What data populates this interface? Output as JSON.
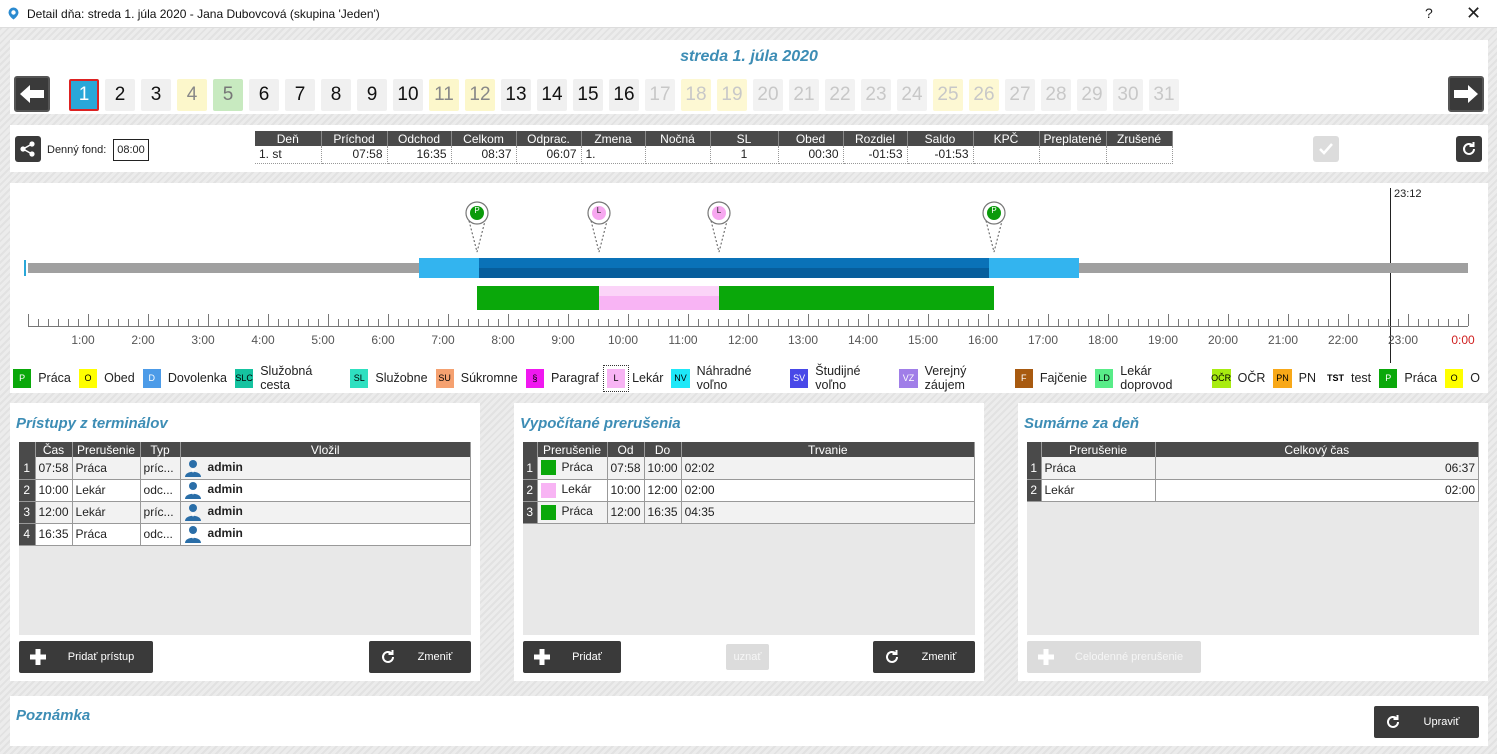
{
  "window": {
    "title": "Detail dňa: streda 1. júla 2020 -  Jana Dubovcová  (skupina 'Jeden')",
    "help": "?",
    "close": "✕"
  },
  "header": {
    "date_title": "streda 1. júla 2020"
  },
  "days": [
    {
      "n": "1",
      "state": "sel"
    },
    {
      "n": "2",
      "state": "norm"
    },
    {
      "n": "3",
      "state": "norm"
    },
    {
      "n": "4",
      "state": "yel"
    },
    {
      "n": "5",
      "state": "grn"
    },
    {
      "n": "6",
      "state": "norm"
    },
    {
      "n": "7",
      "state": "norm"
    },
    {
      "n": "8",
      "state": "norm"
    },
    {
      "n": "9",
      "state": "norm"
    },
    {
      "n": "10",
      "state": "norm"
    },
    {
      "n": "11",
      "state": "yel"
    },
    {
      "n": "12",
      "state": "yel"
    },
    {
      "n": "13",
      "state": "norm"
    },
    {
      "n": "14",
      "state": "norm"
    },
    {
      "n": "15",
      "state": "norm"
    },
    {
      "n": "16",
      "state": "norm"
    },
    {
      "n": "17",
      "state": "dis"
    },
    {
      "n": "18",
      "state": "dyel"
    },
    {
      "n": "19",
      "state": "dyel"
    },
    {
      "n": "20",
      "state": "dis"
    },
    {
      "n": "21",
      "state": "dis"
    },
    {
      "n": "22",
      "state": "dis"
    },
    {
      "n": "23",
      "state": "dis"
    },
    {
      "n": "24",
      "state": "dis"
    },
    {
      "n": "25",
      "state": "dyel"
    },
    {
      "n": "26",
      "state": "dyel"
    },
    {
      "n": "27",
      "state": "dis"
    },
    {
      "n": "28",
      "state": "dis"
    },
    {
      "n": "29",
      "state": "dis"
    },
    {
      "n": "30",
      "state": "dis"
    },
    {
      "n": "31",
      "state": "dis"
    }
  ],
  "fund": {
    "label": "Denný fond:",
    "value": "08:00"
  },
  "summary": {
    "headers": [
      "Deň",
      "Príchod",
      "Odchod",
      "Celkom",
      "Odprac.",
      "Zmena",
      "Nočná",
      "SL",
      "Obed",
      "Rozdiel",
      "Saldo",
      "KPČ",
      "Preplatené",
      "Zrušené"
    ],
    "row": [
      "1. st",
      "07:58",
      "16:35",
      "08:37",
      "06:07",
      "1.",
      "",
      "1",
      "00:30",
      "-01:53",
      "-01:53",
      "",
      "",
      ""
    ]
  },
  "timeline": {
    "now_label": "23:12",
    "hours": [
      "1:00",
      "2:00",
      "3:00",
      "4:00",
      "5:00",
      "6:00",
      "7:00",
      "8:00",
      "9:00",
      "10:00",
      "11:00",
      "12:00",
      "13:00",
      "14:00",
      "15:00",
      "16:00",
      "17:00",
      "18:00",
      "19:00",
      "20:00",
      "21:00",
      "22:00",
      "23:00",
      "0:00"
    ],
    "pins": [
      {
        "code": "P",
        "color": "#0a9a0a"
      },
      {
        "code": "L",
        "color": "#f7a8f0"
      },
      {
        "code": "L",
        "color": "#f7a8f0"
      },
      {
        "code": "P",
        "color": "#0a9a0a"
      }
    ]
  },
  "legend": [
    {
      "code": "P",
      "label": "Práca",
      "color": "#0aa80a",
      "fg": "#fff"
    },
    {
      "code": "O",
      "label": "Obed",
      "color": "#ffff00",
      "fg": "#000"
    },
    {
      "code": "D",
      "label": "Dovolenka",
      "color": "#4c9be8",
      "fg": "#fff"
    },
    {
      "code": "SLC",
      "label": "Služobná cesta",
      "color": "#15c3a0",
      "fg": "#000"
    },
    {
      "code": "SL",
      "label": "Služobne",
      "color": "#2ee0c0",
      "fg": "#000"
    },
    {
      "code": "SU",
      "label": "Súkromne",
      "color": "#f5a170",
      "fg": "#000"
    },
    {
      "code": "§",
      "label": "Paragraf",
      "color": "#f018f0",
      "fg": "#000"
    },
    {
      "code": "L",
      "label": "Lekár",
      "color": "#f8b4f4",
      "fg": "#000"
    },
    {
      "code": "NV",
      "label": "Náhradné voľno",
      "color": "#1ee8f8",
      "fg": "#000"
    },
    {
      "code": "SV",
      "label": "Študijné voľno",
      "color": "#4848e8",
      "fg": "#fff"
    },
    {
      "code": "VZ",
      "label": "Verejný záujem",
      "color": "#a07ee8",
      "fg": "#fff"
    },
    {
      "code": "F",
      "label": "Fajčenie",
      "color": "#a85a10",
      "fg": "#fff"
    },
    {
      "code": "LD",
      "label": "Lekár doprovod",
      "color": "#58ec88",
      "fg": "#000"
    },
    {
      "code": "OČR",
      "label": "OČR",
      "color": "#a8ec10",
      "fg": "#000"
    },
    {
      "code": "PN",
      "label": "PN",
      "color": "#f8a818",
      "fg": "#000"
    },
    {
      "code": "TST",
      "label": "test",
      "color": "#ffffff",
      "fg": "#000"
    },
    {
      "code": "P",
      "label": "Práca",
      "color": "#0aa80a",
      "fg": "#fff"
    },
    {
      "code": "O",
      "label": "O",
      "color": "#ffff00",
      "fg": "#000"
    }
  ],
  "access": {
    "title": "Prístupy z terminálov",
    "headers": [
      "Čas",
      "Prerušenie",
      "Typ",
      "Vložil"
    ],
    "rows": [
      {
        "n": "1",
        "time": "07:58",
        "brk": "Práca",
        "type": "príc...",
        "by": "admin"
      },
      {
        "n": "2",
        "time": "10:00",
        "brk": "Lekár",
        "type": "odc...",
        "by": "admin"
      },
      {
        "n": "3",
        "time": "12:00",
        "brk": "Lekár",
        "type": "príc...",
        "by": "admin"
      },
      {
        "n": "4",
        "time": "16:35",
        "brk": "Práca",
        "type": "odc...",
        "by": "admin"
      }
    ],
    "add": "Pridať prístup",
    "change": "Zmeniť"
  },
  "computed": {
    "title": "Vypočítané prerušenia",
    "headers": [
      "Prerušenie",
      "Od",
      "Do",
      "Trvanie"
    ],
    "rows": [
      {
        "n": "1",
        "color": "#0aa80a",
        "brk": "Práca",
        "from": "07:58",
        "to": "10:00",
        "dur": "02:02"
      },
      {
        "n": "2",
        "color": "#f8b4f4",
        "brk": "Lekár",
        "from": "10:00",
        "to": "12:00",
        "dur": "02:00"
      },
      {
        "n": "3",
        "color": "#0aa80a",
        "brk": "Práca",
        "from": "12:00",
        "to": "16:35",
        "dur": "04:35"
      }
    ],
    "add": "Pridať",
    "accept": "uznať",
    "change": "Zmeniť"
  },
  "daysum": {
    "title": "Sumárne za deň",
    "headers": [
      "Prerušenie",
      "Celkový čas"
    ],
    "rows": [
      {
        "n": "1",
        "brk": "Práca",
        "total": "06:37"
      },
      {
        "n": "2",
        "brk": "Lekár",
        "total": "02:00"
      }
    ],
    "allday": "Celodenné prerušenie"
  },
  "note": {
    "title": "Poznámka",
    "edit": "Upraviť"
  }
}
